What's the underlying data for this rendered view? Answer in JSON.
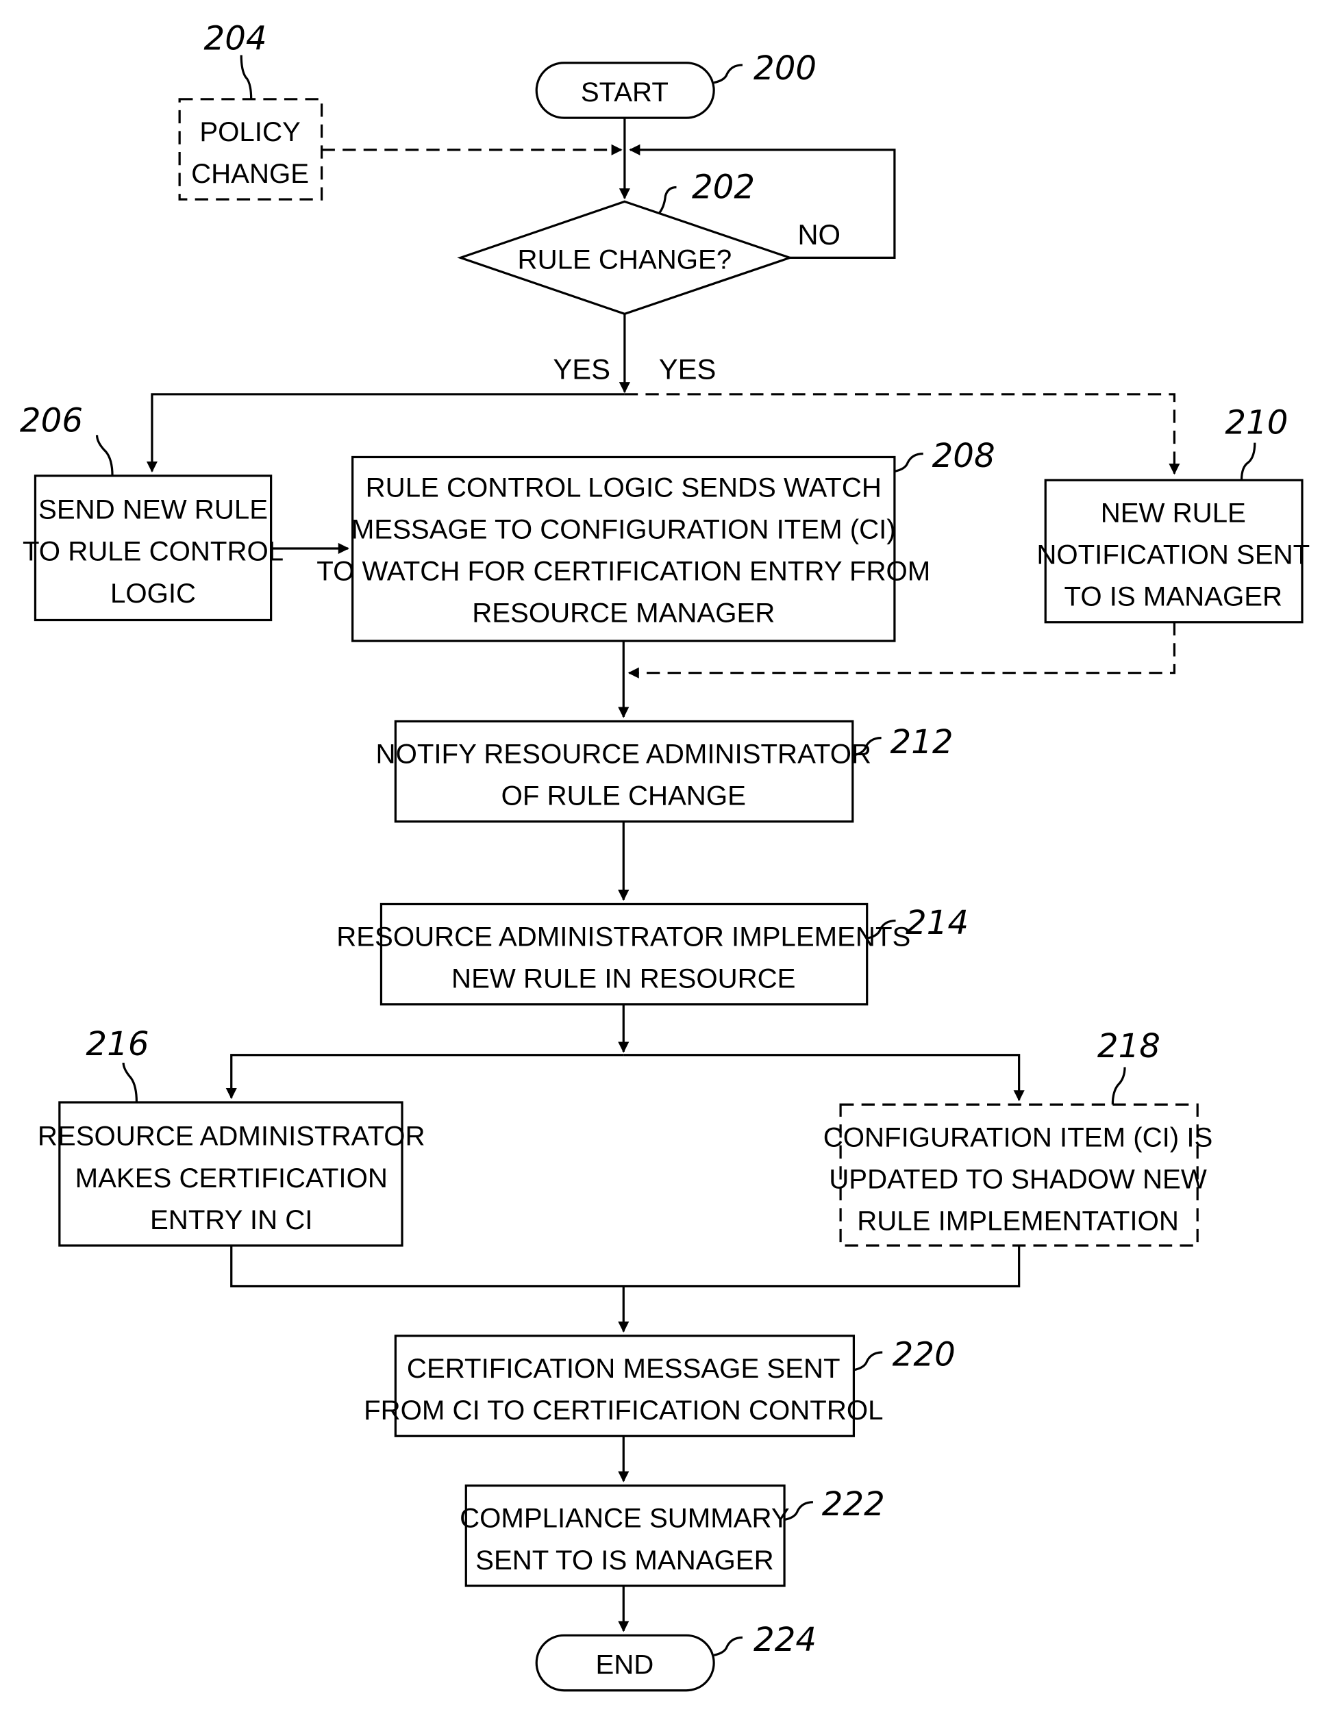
{
  "figure": {
    "nodes": {
      "start": {
        "ref": "200",
        "lines": [
          "START"
        ]
      },
      "rule_change": {
        "ref": "202",
        "lines": [
          "RULE CHANGE?"
        ]
      },
      "policy_change": {
        "ref": "204",
        "lines": [
          "POLICY",
          "CHANGE"
        ]
      },
      "send_new_rule": {
        "ref": "206",
        "lines": [
          "SEND NEW RULE",
          "TO RULE CONTROL",
          "LOGIC"
        ]
      },
      "watch_message": {
        "ref": "208",
        "lines": [
          "RULE CONTROL LOGIC SENDS WATCH",
          "MESSAGE TO CONFIGURATION ITEM (CI)",
          "TO WATCH FOR CERTIFICATION ENTRY FROM",
          "RESOURCE MANAGER"
        ]
      },
      "notification": {
        "ref": "210",
        "lines": [
          "NEW RULE",
          "NOTIFICATION SENT",
          "TO IS MANAGER"
        ]
      },
      "notify_admin": {
        "ref": "212",
        "lines": [
          "NOTIFY RESOURCE ADMINISTRATOR",
          "OF RULE CHANGE"
        ]
      },
      "implement": {
        "ref": "214",
        "lines": [
          "RESOURCE ADMINISTRATOR IMPLEMENTS",
          "NEW RULE IN RESOURCE"
        ]
      },
      "cert_entry": {
        "ref": "216",
        "lines": [
          "RESOURCE ADMINISTRATOR",
          "MAKES CERTIFICATION",
          "ENTRY IN CI"
        ]
      },
      "ci_updated": {
        "ref": "218",
        "lines": [
          "CONFIGURATION ITEM (CI) IS",
          "UPDATED TO SHADOW NEW",
          "RULE IMPLEMENTATION"
        ]
      },
      "cert_message": {
        "ref": "220",
        "lines": [
          "CERTIFICATION MESSAGE SENT",
          "FROM CI TO CERTIFICATION CONTROL"
        ]
      },
      "compliance": {
        "ref": "222",
        "lines": [
          "COMPLIANCE SUMMARY",
          "SENT TO IS MANAGER"
        ]
      },
      "end": {
        "ref": "224",
        "lines": [
          "END"
        ]
      }
    },
    "edge_labels": {
      "no": "NO",
      "yes_left": "YES",
      "yes_right": "YES"
    }
  }
}
